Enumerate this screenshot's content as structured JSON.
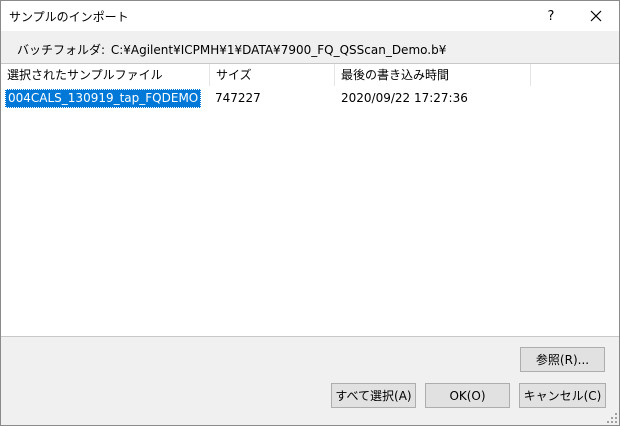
{
  "window": {
    "title": "サンプルのインポート",
    "help_label": "?"
  },
  "batch_folder": {
    "label": "バッチフォルダ:",
    "path": "C:¥Agilent¥ICPMH¥1¥DATA¥7900_FQ_QSScan_Demo.b¥"
  },
  "table": {
    "columns": [
      "選択されたサンプルファイル",
      "サイズ",
      "最後の書き込み時間"
    ],
    "rows": [
      {
        "name": "004CALS_130919_tap_FQDEMO",
        "size": "747227",
        "time": "2020/09/22 17:27:36",
        "selected": true
      }
    ]
  },
  "buttons": {
    "browse": "参照(R)...",
    "select_all": "すべて選択(A)",
    "ok": "OK(O)",
    "cancel": "キャンセル(C)"
  },
  "colors": {
    "selection": "#0078d7",
    "dialog_bg": "#f0f0f0",
    "button_bg": "#e1e1e1"
  }
}
